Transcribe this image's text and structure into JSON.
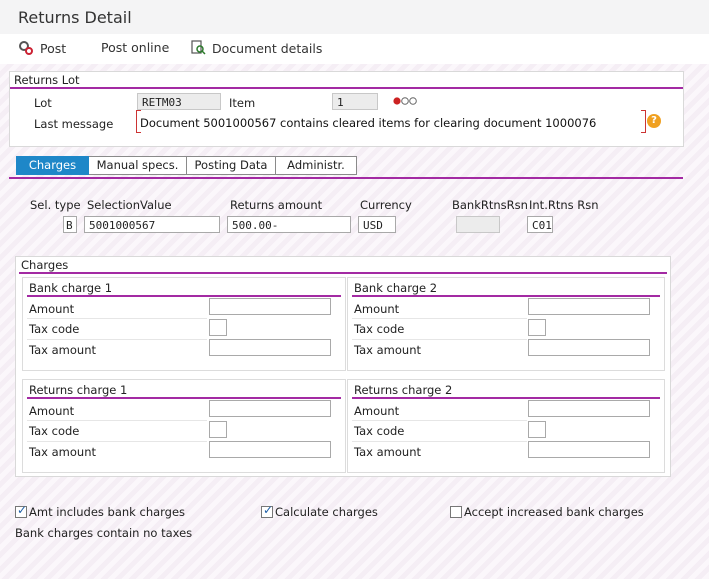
{
  "window": {
    "title": "Returns Detail"
  },
  "toolbar": {
    "post": "Post",
    "post_online": "Post online",
    "document_details": "Document details"
  },
  "returns_lot": {
    "title": "Returns Lot",
    "lot_label": "Lot",
    "lot_value": "RETM03",
    "item_label": "Item",
    "item_value": "1",
    "last_message_label": "Last message",
    "last_message_value": "Document 5001000567 contains cleared items for clearing document 1000076",
    "help": "?"
  },
  "tabs": [
    "Charges",
    "Manual specs.",
    "Posting Data",
    "Administr."
  ],
  "sel": {
    "sel_type_label": "Sel. type",
    "sel_type_value": "B",
    "selection_value_label": "SelectionValue",
    "selection_value": "5001000567",
    "returns_amount_label": "Returns amount",
    "returns_amount": "500.00-",
    "currency_label": "Currency",
    "currency": "USD",
    "bank_rtns_rsn_label": "BankRtnsRsn",
    "bank_rtns_rsn": "",
    "int_rtns_rsn_label": "Int.Rtns Rsn",
    "int_rtns_rsn": "C01"
  },
  "charges": {
    "title": "Charges",
    "bank_charge_1": "Bank charge 1",
    "bank_charge_2": "Bank charge 2",
    "returns_charge_1": "Returns charge 1",
    "returns_charge_2": "Returns charge 2",
    "amount_label": "Amount",
    "tax_code_label": "Tax code",
    "tax_amount_label": "Tax amount"
  },
  "options": {
    "amt_includes_bank_charges": "Amt includes bank charges",
    "amt_includes_bank_charges_checked": true,
    "calculate_charges": "Calculate charges",
    "calculate_charges_checked": true,
    "accept_increased_bank_charges": "Accept increased bank charges",
    "accept_increased_bank_charges_checked": false,
    "note": "Bank charges contain no taxes"
  },
  "colors": {
    "accent_purple": "#a32aa3",
    "active_tab": "#1e87c8",
    "traffic_red": "#cc2222"
  }
}
